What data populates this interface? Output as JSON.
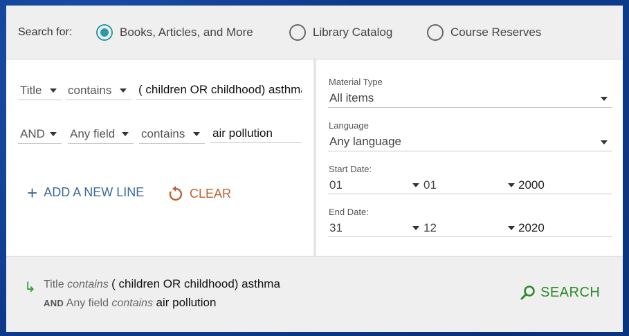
{
  "scope": {
    "label": "Search for:",
    "options": [
      {
        "label": "Books, Articles, and More",
        "checked": true
      },
      {
        "label": "Library Catalog",
        "checked": false
      },
      {
        "label": "Course Reserves",
        "checked": false
      }
    ]
  },
  "query": {
    "rows": [
      {
        "operator": "",
        "field": "Title",
        "precision": "contains",
        "value": "( children OR childhood) asthma"
      },
      {
        "operator": "AND",
        "field": "Any field",
        "precision": "contains",
        "value": "air pollution"
      }
    ],
    "add_line_label": "ADD A NEW LINE",
    "clear_label": "CLEAR"
  },
  "filters": {
    "material_type": {
      "label": "Material Type",
      "value": "All items"
    },
    "language": {
      "label": "Language",
      "value": "Any language"
    },
    "start_date": {
      "label": "Start Date:",
      "day": "01",
      "month": "01",
      "year": "2000"
    },
    "end_date": {
      "label": "End Date:",
      "day": "31",
      "month": "12",
      "year": "2020"
    }
  },
  "summary": {
    "line1": {
      "field": "Title",
      "precision": "contains",
      "value": "( children OR childhood) asthma"
    },
    "line2": {
      "operator": "AND",
      "field": "Any field",
      "precision": "contains",
      "value": "air pollution"
    },
    "search_label": "SEARCH"
  },
  "colors": {
    "accent_teal": "#2a9aa6",
    "add_blue": "#3a6a9a",
    "clear_orange": "#c0602c",
    "search_green": "#2a8a2a",
    "background_blue": "#0d3a8c"
  }
}
